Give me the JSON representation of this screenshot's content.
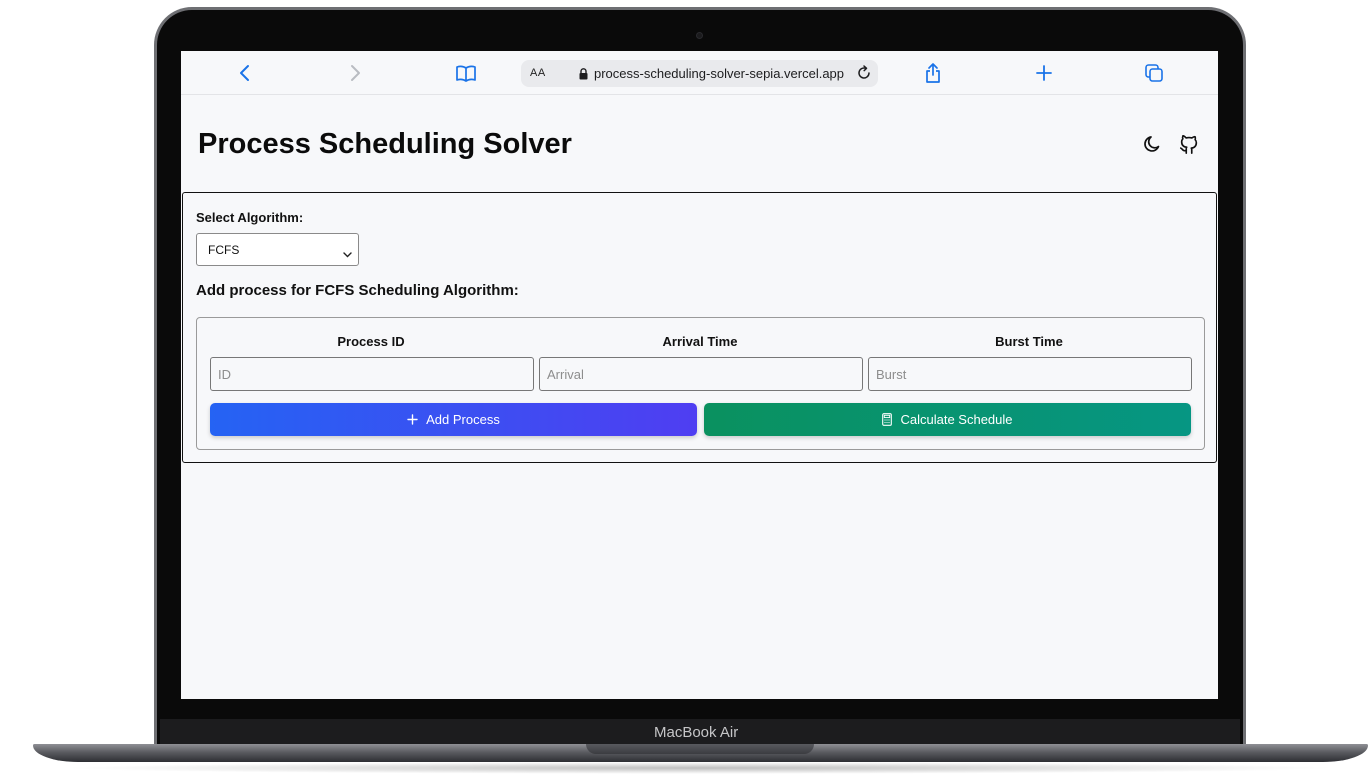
{
  "device": {
    "label": "MacBook Air"
  },
  "browser": {
    "text_size_label": "AA",
    "url": "process-scheduling-solver-sepia.vercel.app",
    "icons": [
      "back-icon",
      "forward-icon",
      "bookmarks-icon",
      "lock-icon",
      "reload-icon",
      "share-icon",
      "new-tab-icon",
      "tabs-icon"
    ],
    "accent_color": "#1a73e8"
  },
  "header": {
    "title": "Process Scheduling Solver",
    "icons": [
      "dark-mode-moon-icon",
      "github-icon"
    ]
  },
  "form": {
    "select_label": "Select Algorithm:",
    "algorithm_selected": "FCFS",
    "heading": "Add process for FCFS Scheduling Algorithm:",
    "columns": {
      "process_id": "Process ID",
      "arrival_time": "Arrival Time",
      "burst_time": "Burst Time"
    },
    "placeholders": {
      "id": "ID",
      "arrival": "Arrival",
      "burst": "Burst"
    },
    "values": {
      "id": "",
      "arrival": "",
      "burst": ""
    },
    "add_button_label": "Add Process",
    "calculate_button_label": "Calculate Schedule",
    "add_button_colors": [
      "#2563f3",
      "#4f3ef2"
    ],
    "calculate_button_colors": [
      "#0a915f",
      "#069683"
    ]
  }
}
